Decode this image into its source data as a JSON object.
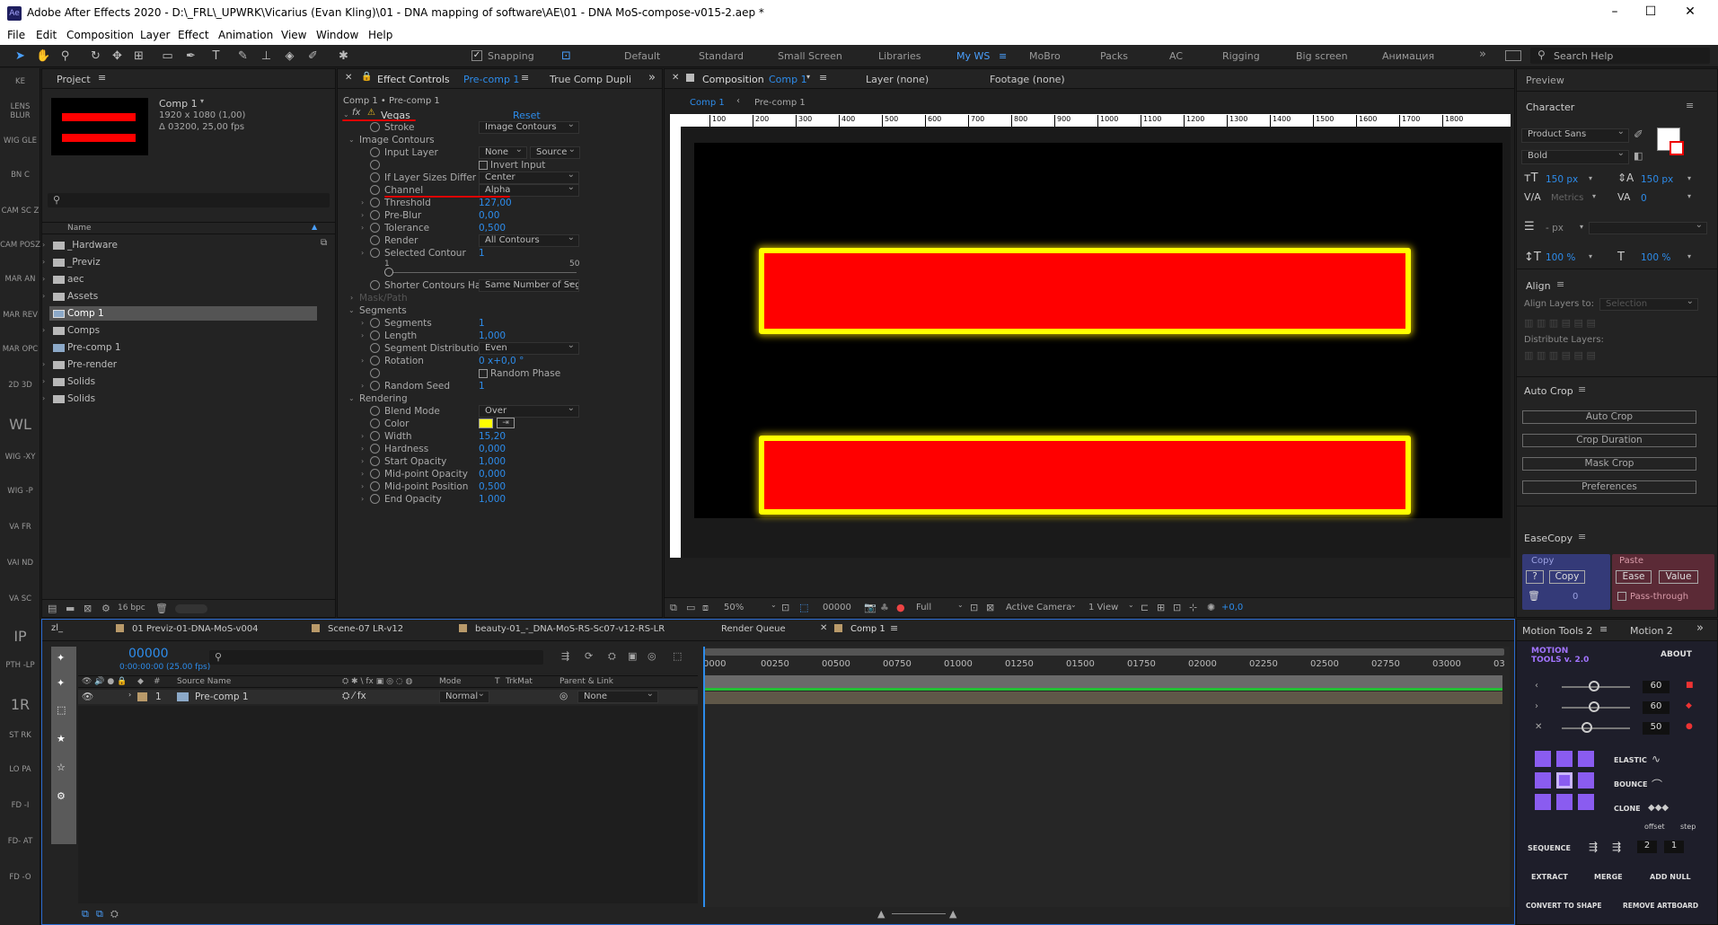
{
  "app": {
    "title": "Adobe After Effects 2020 - D:\\_FRL\\_UPWRK\\Vicarius (Evan Kling)\\01 - DNA mapping of software\\AE\\01 - DNA MoS-compose-v015-2.aep *",
    "logo": "Ae"
  },
  "menu": [
    "File",
    "Edit",
    "Composition",
    "Layer",
    "Effect",
    "Animation",
    "View",
    "Window",
    "Help"
  ],
  "toolbar": {
    "snapping": "Snapping",
    "workspaces": [
      "Default",
      "Standard",
      "Small Screen",
      "Libraries",
      "My WS",
      "MoBro",
      "Packs",
      "AC",
      "Rigging",
      "Big screen",
      "Анимация"
    ],
    "active_ws": "My WS",
    "search": "Search Help"
  },
  "leftbar": [
    "KE",
    "LENS BLUR",
    "WIG GLE",
    "BN C",
    "CAM SC Z",
    "CAM POSZ",
    "MAR AN",
    "MAR REV",
    "MAR OPC",
    "2D 3D",
    "WL",
    "WIG -XY",
    "WIG -P",
    "VA FR",
    "VAI ND",
    "VA SC",
    "IP",
    "PTH -LP",
    "1R",
    "ST RK",
    "LO PA",
    "FD -I",
    "FD- AT",
    "FD -O"
  ],
  "project": {
    "tab": "Project",
    "comp_name": "Comp 1",
    "comp_info": "1920 x 1080 (1,00)",
    "comp_dur": "Δ 03200, 25,00 fps",
    "col_name": "Name",
    "items": [
      {
        "name": "_Hardware",
        "type": "folder"
      },
      {
        "name": "_Previz",
        "type": "folder"
      },
      {
        "name": "aec",
        "type": "folder"
      },
      {
        "name": "Assets",
        "type": "folder"
      },
      {
        "name": "Comp 1",
        "type": "comp",
        "selected": true
      },
      {
        "name": "Comps",
        "type": "folder"
      },
      {
        "name": "Pre-comp 1",
        "type": "comp"
      },
      {
        "name": "Pre-render",
        "type": "folder"
      },
      {
        "name": "Solids",
        "type": "folder"
      },
      {
        "name": "Solids",
        "type": "folder"
      }
    ],
    "bpc": "16 bpc"
  },
  "effects": {
    "tab": "Effect Controls",
    "tab_target": "Pre-comp 1",
    "tab2": "True Comp Dupli",
    "breadcrumb": "Comp 1 • Pre-comp 1",
    "fx_name": "Vegas",
    "reset": "Reset",
    "rows": [
      {
        "label": "Stroke",
        "dd": "Image Contours",
        "indent": 2
      },
      {
        "label": "Image Contours",
        "indent": 1,
        "group": true
      },
      {
        "label": "Input Layer",
        "dd": "None",
        "dd2": "Source",
        "indent": 2
      },
      {
        "label": "",
        "check": "Invert Input",
        "indent": 2
      },
      {
        "label": "If Layer Sizes Differ",
        "dd": "Center",
        "indent": 2
      },
      {
        "label": "Channel",
        "dd": "Alpha",
        "indent": 2
      },
      {
        "label": "Threshold",
        "value": "127,00",
        "indent": 2
      },
      {
        "label": "Pre-Blur",
        "value": "0,00",
        "indent": 2
      },
      {
        "label": "Tolerance",
        "value": "0,500",
        "indent": 2
      },
      {
        "label": "Render",
        "dd": "All Contours",
        "indent": 2
      },
      {
        "label": "Selected Contour",
        "value": "1",
        "indent": 2
      },
      {
        "label": "slider",
        "indent": 2
      },
      {
        "label": "Shorter Contours Have",
        "dd": "Same Number of Segme",
        "indent": 2
      },
      {
        "label": "Mask/Path",
        "indent": 1,
        "disabled": true
      },
      {
        "label": "Segments",
        "indent": 1,
        "group": true
      },
      {
        "label": "Segments",
        "value": "1",
        "indent": 2
      },
      {
        "label": "Length",
        "value": "1,000",
        "indent": 2
      },
      {
        "label": "Segment Distribution",
        "dd": "Even",
        "indent": 2
      },
      {
        "label": "Rotation",
        "value": "0 x+0,0 °",
        "indent": 2
      },
      {
        "label": "",
        "check": "Random Phase",
        "indent": 2
      },
      {
        "label": "Random Seed",
        "value": "1",
        "indent": 2
      },
      {
        "label": "Rendering",
        "indent": 1,
        "group": true
      },
      {
        "label": "Blend Mode",
        "dd": "Over",
        "indent": 2
      },
      {
        "label": "Color",
        "color": "#ffff00",
        "indent": 2
      },
      {
        "label": "Width",
        "value": "15,20",
        "indent": 2
      },
      {
        "label": "Hardness",
        "value": "0,000",
        "indent": 2
      },
      {
        "label": "Start Opacity",
        "value": "1,000",
        "indent": 2
      },
      {
        "label": "Mid-point Opacity",
        "value": "0,000",
        "indent": 2
      },
      {
        "label": "Mid-point Position",
        "value": "0,500",
        "indent": 2
      },
      {
        "label": "End Opacity",
        "value": "1,000",
        "indent": 2
      }
    ],
    "slider_min": "1",
    "slider_max": "50"
  },
  "composition": {
    "tab": "Composition",
    "tab_target": "Comp 1",
    "layer_tab": "Layer (none)",
    "footage_tab": "Footage (none)",
    "crumbs": [
      "Comp 1",
      "Pre-comp 1"
    ],
    "ruler": [
      "100",
      "200",
      "300",
      "400",
      "500",
      "600",
      "700",
      "800",
      "900",
      "1000",
      "1100",
      "1200",
      "1300",
      "1400",
      "1500",
      "1600",
      "1700",
      "1800"
    ],
    "zoom": "50%",
    "time": "00000",
    "quality": "Full",
    "camera": "Active Camera",
    "view": "1 View",
    "exposure": "+0,0"
  },
  "right": {
    "preview": "Preview",
    "character": "Character",
    "font": "Product Sans",
    "style": "Bold",
    "size": "150 px",
    "leading": "150 px",
    "tracking_lbl": "Metrics",
    "tracking": "0",
    "indent": "- px",
    "vscale": "100 %",
    "hscale": "100 %",
    "align": "Align",
    "align_to": "Align Layers to:",
    "align_sel": "Selection",
    "distribute": "Distribute Layers:",
    "autocrop": "Auto Crop",
    "ac_btns": [
      "Auto Crop",
      "Crop Duration",
      "Mask Crop",
      "Preferences"
    ],
    "easecopy": "EaseCopy",
    "copy": "Copy",
    "paste": "Paste",
    "copy_btn": "Copy",
    "ease_btn": "Ease",
    "value_btn": "Value",
    "q": "?",
    "zero": "0",
    "passthrough": "Pass-through"
  },
  "timeline": {
    "tabs": [
      "01 Previz-01-DNA-MoS-v004",
      "Scene-07 LR-v12",
      "beauty-01_-_DNA-MoS-RS-Sc07-v12-RS-LR",
      "Render Queue",
      "Comp 1"
    ],
    "active_tab": "Comp 1",
    "timecode": "00000",
    "sub_time": "0:00:00:00 (25.00 fps)",
    "cols": {
      "source": "Source Name",
      "mode": "Mode",
      "t": "T",
      "trkmat": "TrkMat",
      "parent": "Parent & Link"
    },
    "layer": {
      "num": "1",
      "name": "Pre-comp 1",
      "mode": "Normal",
      "parent": "None"
    },
    "ticks": [
      "0000",
      "00250",
      "00500",
      "00750",
      "01000",
      "01250",
      "01500",
      "01750",
      "02000",
      "02250",
      "02500",
      "02750",
      "03000",
      "03"
    ]
  },
  "motion": {
    "tab": "Motion Tools 2",
    "tab2": "Motion 2",
    "logo1": "MOTION",
    "logo2": "TOOLS v. 2.0",
    "about": "ABOUT",
    "v1": "60",
    "v2": "60",
    "v3": "50",
    "elastic": "ELASTIC",
    "bounce": "BOUNCE",
    "clone": "CLONE",
    "offset": "offset",
    "step": "step",
    "sequence": "SEQUENCE",
    "seq1": "2",
    "seq2": "1",
    "extract": "EXTRACT",
    "merge": "MERGE",
    "addnull": "ADD NULL",
    "convert": "CONVERT TO SHAPE",
    "remove": "REMOVE ARTBOARD"
  }
}
